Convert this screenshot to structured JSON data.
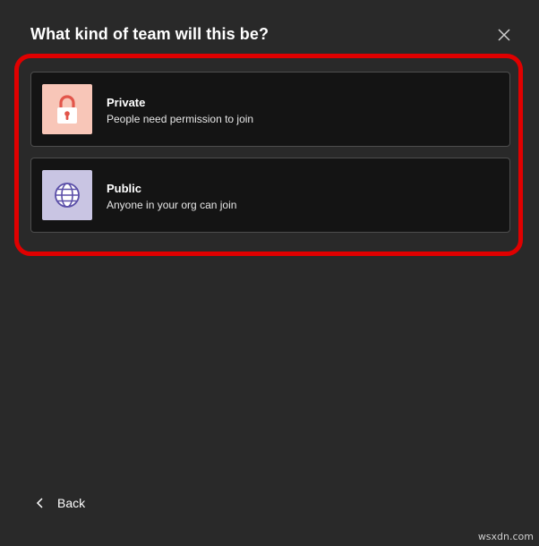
{
  "dialog": {
    "title": "What kind of team will this be?"
  },
  "options": [
    {
      "title": "Private",
      "description": "People need permission to join",
      "icon": "lock-icon",
      "icon_bg": "#f8c6b8",
      "icon_color": "#e2554a"
    },
    {
      "title": "Public",
      "description": "Anyone in your org can join",
      "icon": "globe-icon",
      "icon_bg": "#c9c5e3",
      "icon_color": "#5b4fa8"
    }
  ],
  "footer": {
    "back_label": "Back"
  },
  "annotation": {
    "highlight_color": "#e00000"
  },
  "watermark": "wsxdn.com"
}
